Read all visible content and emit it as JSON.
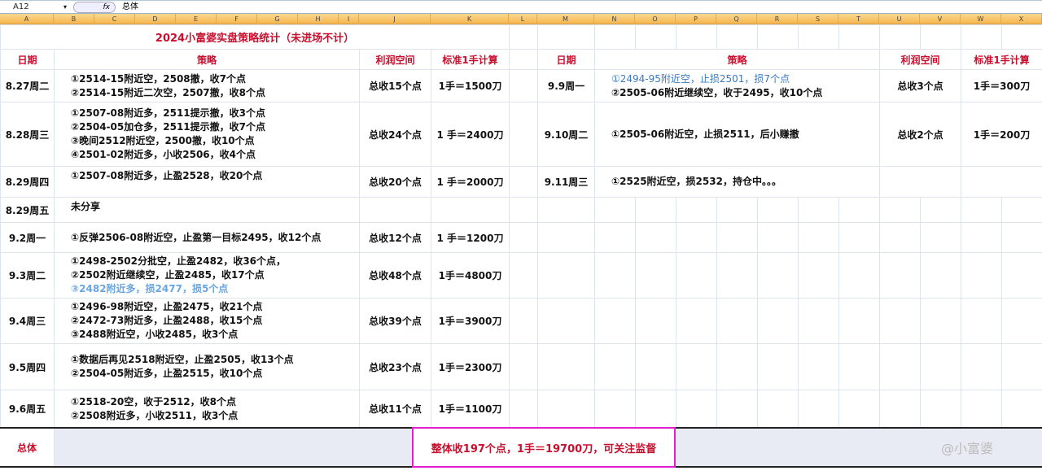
{
  "formula_bar": {
    "cell_ref": "A12",
    "fx": "fx",
    "value": "总体"
  },
  "columns": [
    "A",
    "B",
    "C",
    "D",
    "E",
    "F",
    "G",
    "H",
    "I",
    "J",
    "K",
    "L",
    "M",
    "N",
    "O",
    "P",
    "Q",
    "R",
    "S",
    "T",
    "U",
    "V",
    "W",
    "X"
  ],
  "title": "2024小富婆实盘策略统计（未进场不计）",
  "headers": {
    "date": "日期",
    "strategy": "策略",
    "profit": "利润空间",
    "standard": "标准1手计算"
  },
  "left_rows": [
    {
      "date": "8.27周二",
      "lines": [
        {
          "t": "①2514-15附近空，2508撤，收7个点"
        },
        {
          "t": "②2514-15附近二次空，2507撤，收8个点"
        }
      ],
      "profit": "总收15个点",
      "std": "1手＝1500刀"
    },
    {
      "date": "8.28周三",
      "lines": [
        {
          "t": "①2507-08附近多，2511提示撤，收3个点"
        },
        {
          "t": "②2504-05加仓多，2511提示撤，收7个点"
        },
        {
          "t": "③晚间2512附近空，2500撤，收10个点"
        },
        {
          "t": "④2501-02附近多，小收2506，收4个点"
        }
      ],
      "profit": "总收24个点",
      "std": "1 手＝2400刀"
    },
    {
      "date": "8.29周四",
      "lines": [
        {
          "t": "①2507-08附近多，止盈2528，收20个点"
        }
      ],
      "profit": "总收20个点",
      "std": "1 手＝2000刀",
      "top": true
    },
    {
      "date": "8.29周五",
      "lines": [
        {
          "t": "未分享"
        }
      ],
      "profit": "",
      "std": "",
      "top": true
    },
    {
      "date": "9.2周一",
      "lines": [
        {
          "t": "①反弹2506-08附近空，止盈第一目标2495，收12个点"
        }
      ],
      "profit": "总收12个点",
      "std": "1 手＝1200刀"
    },
    {
      "date": "9.3周二",
      "lines": [
        {
          "t": "①2498-2502分批空，止盈2482，收36个点，"
        },
        {
          "t": "②2502附近继续空，止盈2485，收17个点"
        },
        {
          "t": "③2482附近多，损2477，损5个点",
          "c": "lblue"
        }
      ],
      "profit": "总收48个点",
      "std": "1手＝4800刀"
    },
    {
      "date": "9.4周三",
      "lines": [
        {
          "t": "①2496-98附近空，止盈2475，收21个点"
        },
        {
          "t": "②2472-73附近多，止盈2488，收15个点"
        },
        {
          "t": "③2488附近空，小收2485，收3个点"
        }
      ],
      "profit": "总收39个点",
      "std": "1手＝3900刀"
    },
    {
      "date": "9.5周四",
      "lines": [
        {
          "t": "①数据后再见2518附近空，止盈2505，收13个点"
        },
        {
          "t": "②2504-05附近多，止盈2515，收10个点"
        }
      ],
      "profit": "总收23个点",
      "std": "1手＝2300刀"
    },
    {
      "date": "9.6周五",
      "lines": [
        {
          "t": "①2518-20空，收于2512，收8个点"
        },
        {
          "t": "②2508附近多，小收2511，收3个点"
        }
      ],
      "profit": "总收11个点",
      "std": "1手＝1100刀"
    }
  ],
  "right_rows": [
    {
      "date": "9.9周一",
      "lines": [
        {
          "t": "①2494-95附近空，止损2501，损7个点",
          "c": "blue"
        },
        {
          "t": "②2505-06附近继续空，收于2495，收10个点"
        }
      ],
      "profit": "总收3个点",
      "std": "1手＝300刀"
    },
    {
      "date": "9.10周二",
      "lines": [
        {
          "t": "①2505-06附近空，止损2511，后小赚撤"
        }
      ],
      "profit": "总收2个点",
      "std": "1手＝200刀"
    },
    {
      "date": "9.11周三",
      "lines": [
        {
          "t": "①2525附近空，损2532，持仓中。。。"
        }
      ],
      "profit": "",
      "std": ""
    }
  ],
  "total": {
    "label": "总体",
    "summary": "整体收197个点，1手＝19700刀，可关注监督"
  },
  "watermark": "@小富婆",
  "colors": {
    "header_red": "#c8102e",
    "loss_blue": "#3a78c2",
    "total_border": "#e020d0"
  }
}
